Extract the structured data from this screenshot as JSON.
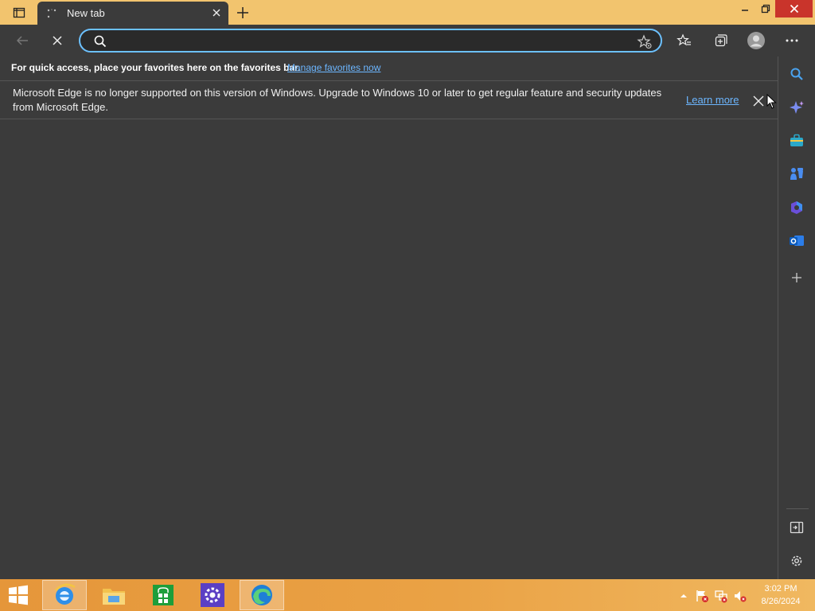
{
  "window": {
    "tab_title": "New tab",
    "controls": {
      "minimize_icon": "minimize-icon",
      "restore_icon": "restore-icon",
      "close_icon": "close-icon"
    },
    "accent": "#f2c46e",
    "close_color": "#c9342b"
  },
  "toolbar": {
    "address_value": "",
    "address_placeholder": "",
    "icons": [
      "back-icon",
      "stop-loading-icon",
      "search-icon",
      "add-favorite-icon",
      "favorites-icon",
      "collections-icon",
      "profile-icon",
      "more-icon"
    ]
  },
  "favorites_bar": {
    "message": "For quick access, place your favorites here on the favorites bar.",
    "link": "Manage favorites now"
  },
  "info_bar": {
    "message": "Microsoft Edge is no longer supported on this version of Windows. Upgrade to Windows 10 or later to get regular feature and security updates from Microsoft Edge.",
    "link": "Learn more"
  },
  "sidebar": {
    "items": [
      "search-icon",
      "copilot-icon",
      "shopping-icon",
      "games-icon",
      "office-icon",
      "outlook-icon",
      "add-icon"
    ],
    "bottom": [
      "hide-sidebar-icon",
      "settings-icon"
    ]
  },
  "taskbar": {
    "apps": [
      "internet-explorer-icon",
      "file-explorer-icon",
      "store-icon",
      "settings-app-icon",
      "edge-icon"
    ],
    "clock_time": "3:02 PM",
    "clock_date": "8/26/2024",
    "tray": [
      "show-hidden-icons",
      "action-center-flag-icon",
      "network-icon",
      "volume-muted-icon"
    ]
  },
  "colors": {
    "link": "#6cb6ff",
    "focus_ring": "#6cc1ff",
    "background": "#3b3b3b"
  }
}
